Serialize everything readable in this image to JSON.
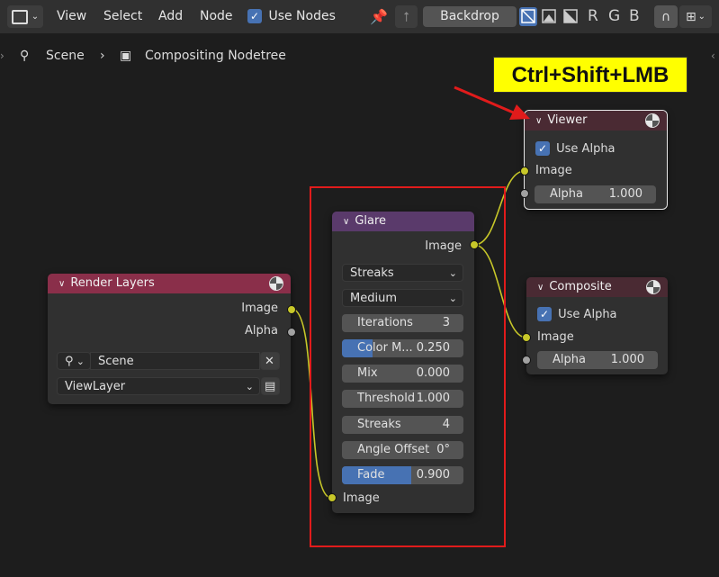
{
  "header": {
    "menu": [
      "View",
      "Select",
      "Add",
      "Node"
    ],
    "use_nodes_label": "Use Nodes",
    "backdrop_label": "Backdrop",
    "channels": [
      "R",
      "G",
      "B"
    ]
  },
  "breadcrumb": {
    "scene": "Scene",
    "tree": "Compositing Nodetree"
  },
  "annotation": {
    "shortcut": "Ctrl+Shift+LMB"
  },
  "nodes": {
    "render_layers": {
      "title": "Render Layers",
      "out_image": "Image",
      "out_alpha": "Alpha",
      "scene": "Scene",
      "view_layer": "ViewLayer"
    },
    "glare": {
      "title": "Glare",
      "out_image": "Image",
      "type": "Streaks",
      "quality": "Medium",
      "fields": [
        {
          "label": "Iterations",
          "value": "3"
        },
        {
          "label": "Color M...",
          "value": "0.250",
          "fill": 0.25
        },
        {
          "label": "Mix",
          "value": "0.000"
        },
        {
          "label": "Threshold",
          "value": "1.000"
        },
        {
          "label": "Streaks",
          "value": "4"
        },
        {
          "label": "Angle Offset",
          "value": "0°"
        },
        {
          "label": "Fade",
          "value": "0.900",
          "fill": 0.57
        }
      ],
      "in_image": "Image"
    },
    "viewer": {
      "title": "Viewer",
      "use_alpha": "Use Alpha",
      "in_image": "Image",
      "alpha_label": "Alpha",
      "alpha_value": "1.000"
    },
    "composite": {
      "title": "Composite",
      "use_alpha": "Use Alpha",
      "in_image": "Image",
      "alpha_label": "Alpha",
      "alpha_value": "1.000"
    }
  },
  "colors": {
    "accent": "#4772b3",
    "highlight_box": "#e11b1b",
    "annotation_bg": "#ffff00"
  }
}
